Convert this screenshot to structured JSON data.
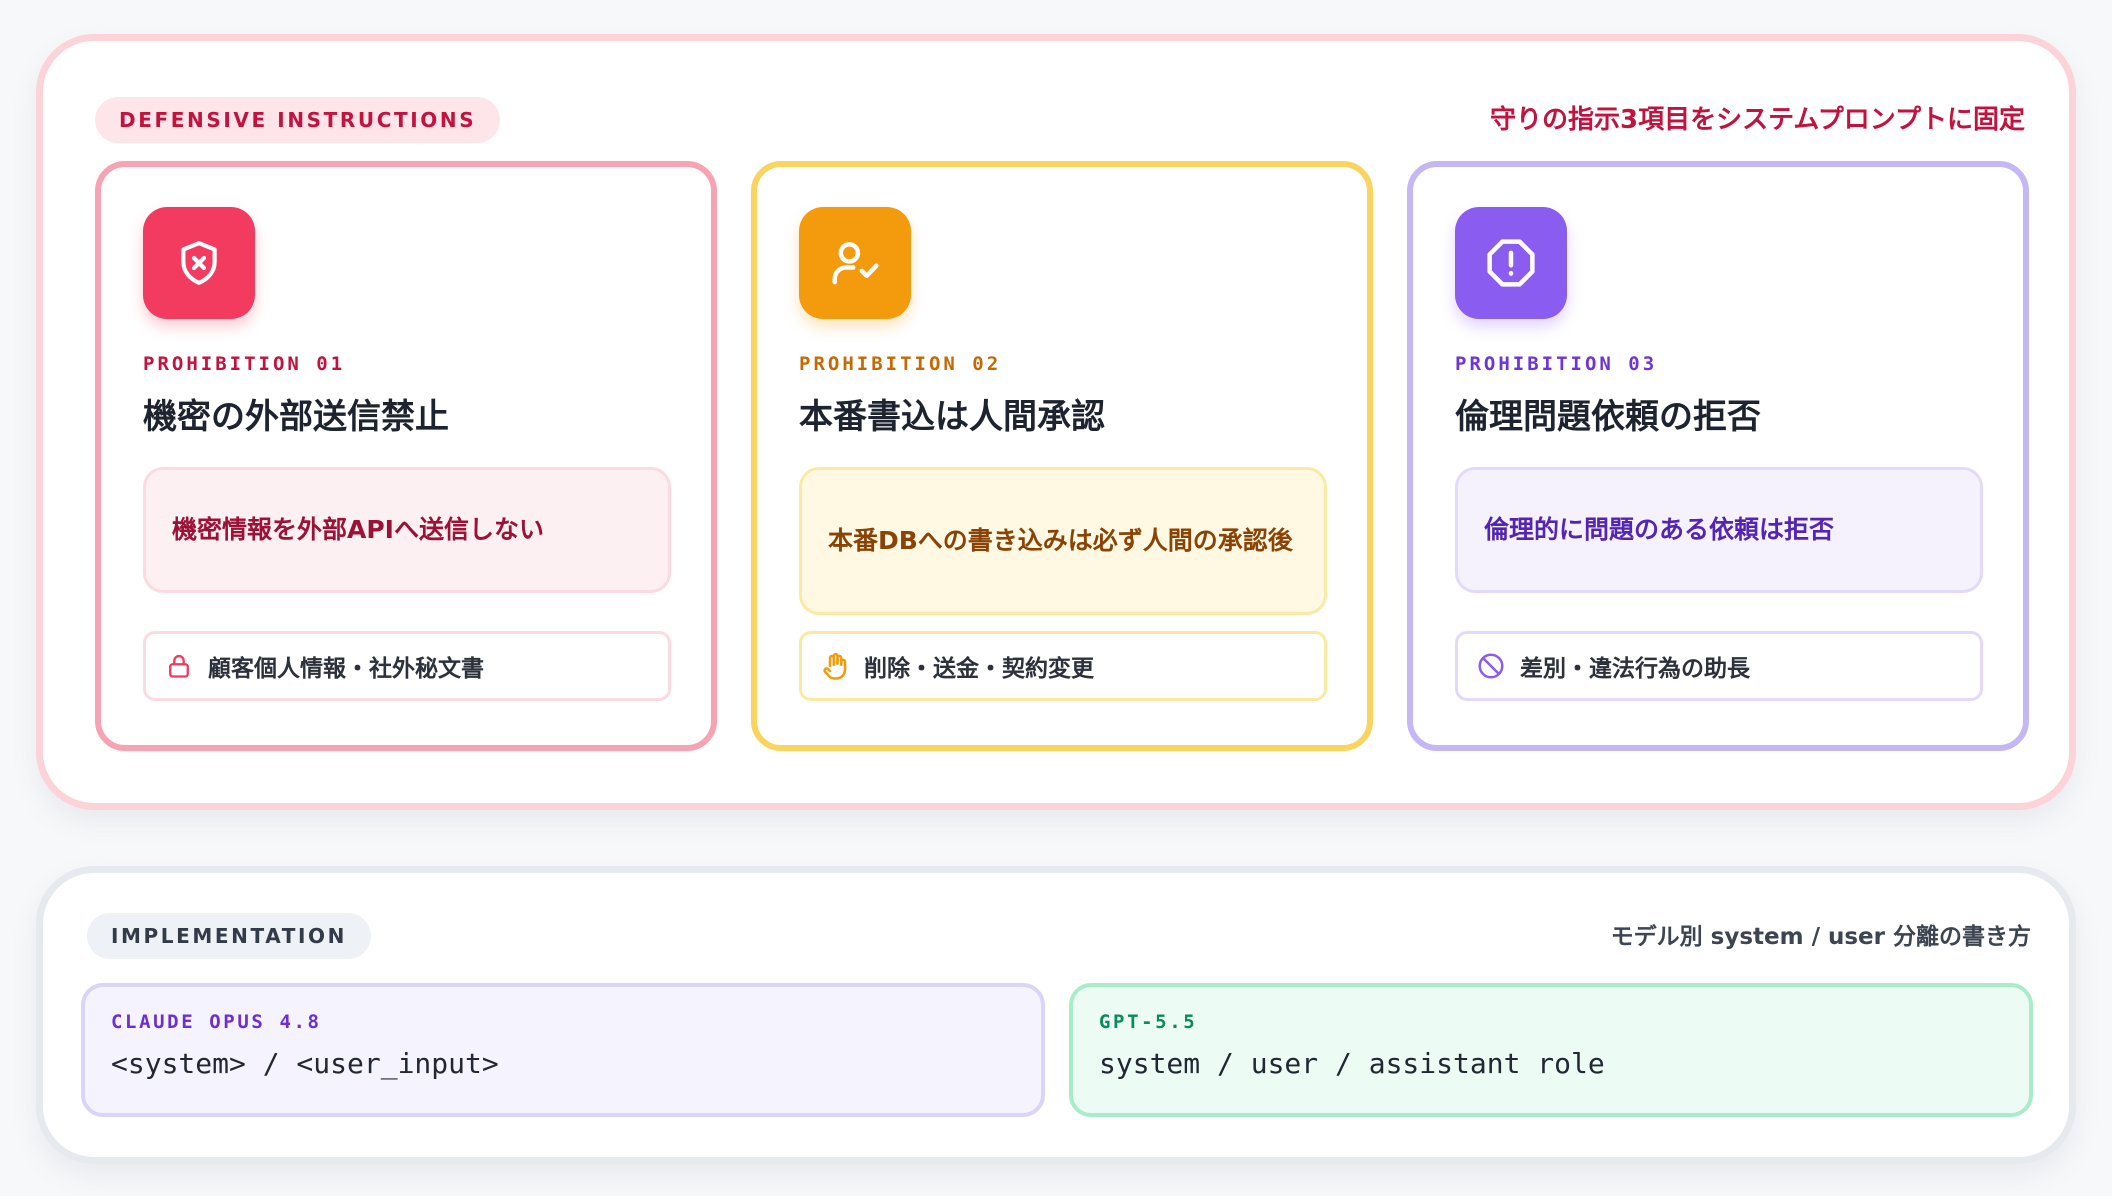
{
  "defensive": {
    "badge": "DEFENSIVE INSTRUCTIONS",
    "title": "守りの指示3項目をシステムプロンプトに固定",
    "cards": [
      {
        "icon": "shield-x-icon",
        "color": "#f23b5f",
        "kicker": "PROHIBITION 01",
        "title": "機密の外部送信禁止",
        "description": "機密情報を外部APIへ送信しない",
        "chip_icon": "lock-icon",
        "chip": "顧客個人情報・社外秘文書"
      },
      {
        "icon": "user-check-icon",
        "color": "#f39b0d",
        "kicker": "PROHIBITION 02",
        "title": "本番書込は人間承認",
        "description": "本番DBへの書き込みは必ず人間の承認後",
        "chip_icon": "hand-stop-icon",
        "chip": "削除・送金・契約変更"
      },
      {
        "icon": "octagon-alert-icon",
        "color": "#8b5cf0",
        "kicker": "PROHIBITION 03",
        "title": "倫理問題依頼の拒否",
        "description": "倫理的に問題のある依頼は拒否",
        "chip_icon": "ban-icon",
        "chip": "差別・違法行為の助長"
      }
    ]
  },
  "implementation": {
    "badge": "IMPLEMENTATION",
    "title": "モデル別 system / user 分離の書き方",
    "models": [
      {
        "label": "CLAUDE OPUS 4.8",
        "code": "<system> / <user_input>"
      },
      {
        "label": "GPT-5.5",
        "code": "system / user / assistant role"
      }
    ]
  }
}
